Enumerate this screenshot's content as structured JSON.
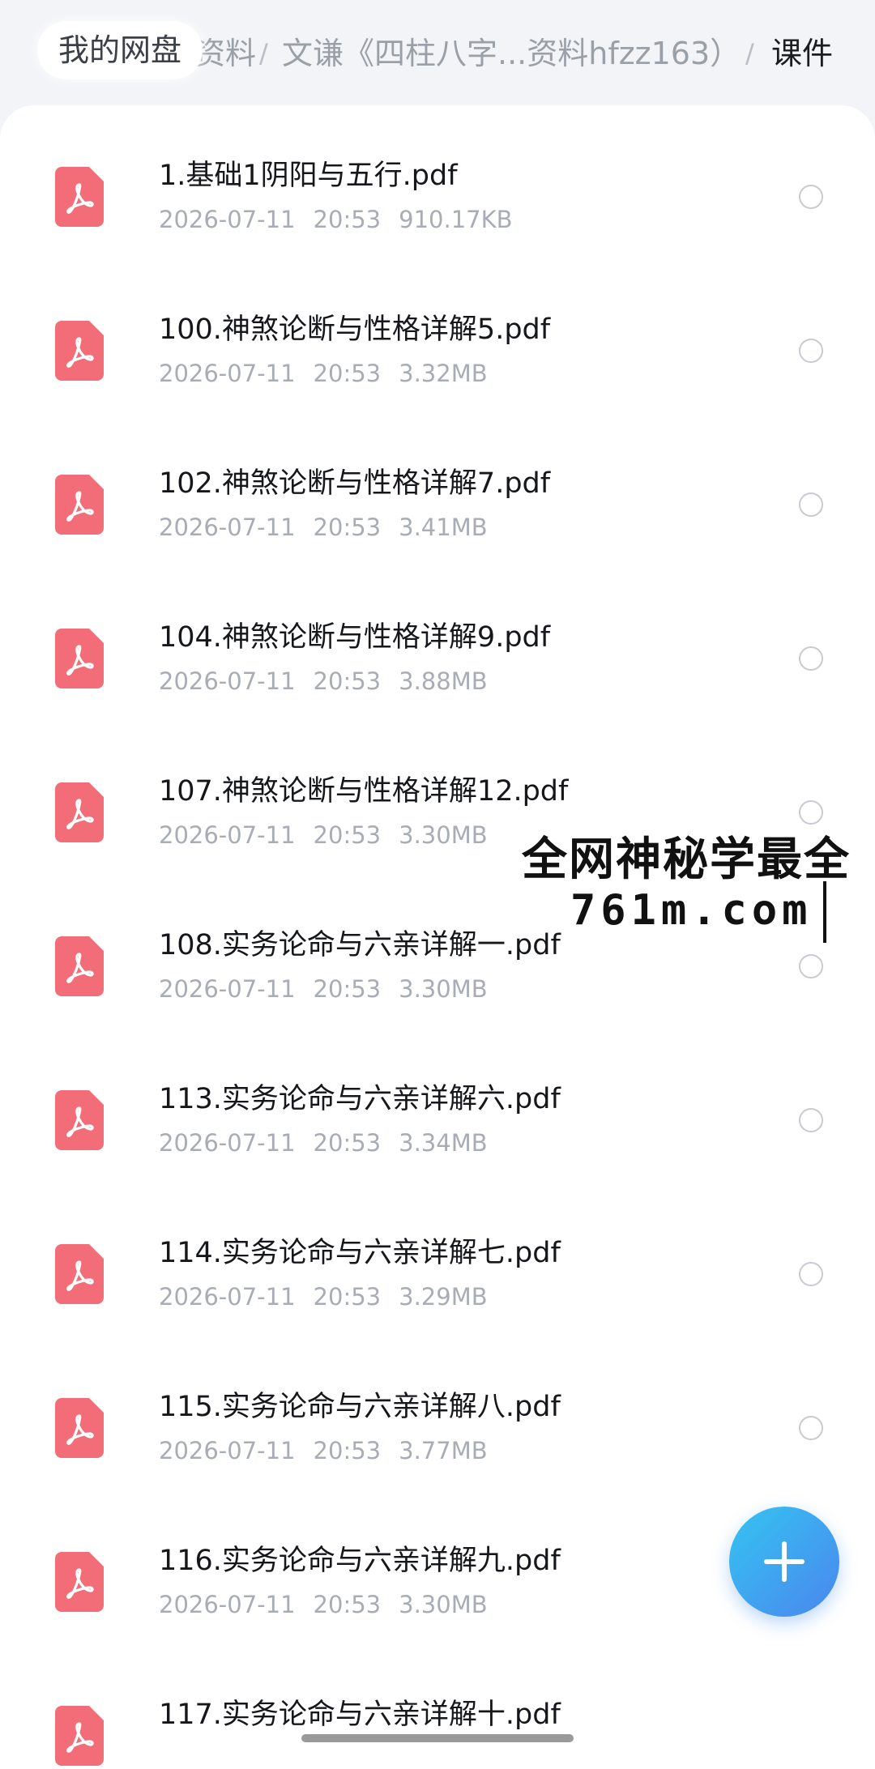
{
  "breadcrumb": {
    "home": "我的网盘",
    "parent1_partial": "资料",
    "parent2": "文谦《四柱八字...资料hfzz163）",
    "current": "课件",
    "separator": "/"
  },
  "files": [
    {
      "name": "1.基础1阴阳与五行.pdf",
      "date": "2026-07-11",
      "time": "20:53",
      "size": "910.17KB"
    },
    {
      "name": "100.神煞论断与性格详解5.pdf",
      "date": "2026-07-11",
      "time": "20:53",
      "size": "3.32MB"
    },
    {
      "name": "102.神煞论断与性格详解7.pdf",
      "date": "2026-07-11",
      "time": "20:53",
      "size": "3.41MB"
    },
    {
      "name": "104.神煞论断与性格详解9.pdf",
      "date": "2026-07-11",
      "time": "20:53",
      "size": "3.88MB"
    },
    {
      "name": "107.神煞论断与性格详解12.pdf",
      "date": "2026-07-11",
      "time": "20:53",
      "size": "3.30MB"
    },
    {
      "name": "108.实务论命与六亲详解一.pdf",
      "date": "2026-07-11",
      "time": "20:53",
      "size": "3.30MB"
    },
    {
      "name": "113.实务论命与六亲详解六.pdf",
      "date": "2026-07-11",
      "time": "20:53",
      "size": "3.34MB"
    },
    {
      "name": "114.实务论命与六亲详解七.pdf",
      "date": "2026-07-11",
      "time": "20:53",
      "size": "3.29MB"
    },
    {
      "name": "115.实务论命与六亲详解八.pdf",
      "date": "2026-07-11",
      "time": "20:53",
      "size": "3.77MB"
    },
    {
      "name": "116.实务论命与六亲详解九.pdf",
      "date": "2026-07-11",
      "time": "20:53",
      "size": "3.30MB"
    },
    {
      "name": "117.实务论命与六亲详解十.pdf",
      "date": "",
      "time": "",
      "size": ""
    }
  ],
  "watermark": {
    "line1": "全网神秘学最全",
    "line2": "761m.com"
  },
  "fab_icon": "plus-icon",
  "colors": {
    "pdf_icon": "#f26d78",
    "fab_start": "#35c4f1",
    "fab_end": "#4a86ee",
    "background": "#f3f4f7"
  }
}
